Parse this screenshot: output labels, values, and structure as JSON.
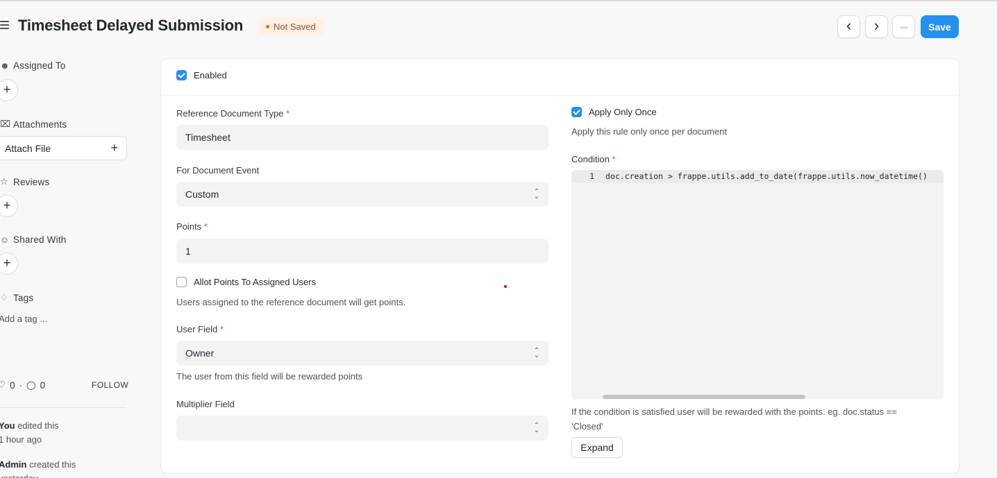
{
  "header": {
    "title": "Timesheet Delayed Submission",
    "status": "Not Saved",
    "prev_icon": "‹",
    "next_icon": "›",
    "more_icon": "···",
    "save_label": "Save"
  },
  "sidebar": {
    "assigned_to": "Assigned To",
    "attachments": "Attachments",
    "attach_file": "Attach File",
    "reviews": "Reviews",
    "shared_with": "Shared With",
    "tags": "Tags",
    "add_tag": "Add a tag ...",
    "likes": "0",
    "comments": "0",
    "follow": "FOLLOW",
    "activity": [
      {
        "who": "You",
        "text": " edited this",
        "when": "1 hour ago"
      },
      {
        "who": "Admin",
        "text": " created this",
        "when": "yesterday"
      }
    ]
  },
  "form": {
    "enabled_label": "Enabled",
    "enabled_checked": true,
    "reference_doctype_label": "Reference Document Type",
    "reference_doctype_value": "Timesheet",
    "doc_event_label": "For Document Event",
    "doc_event_value": "Custom",
    "points_label": "Points",
    "points_value": "1",
    "allot_label": "Allot Points To Assigned Users",
    "allot_checked": false,
    "allot_desc": "Users assigned to the reference document will get points.",
    "user_field_label": "User Field",
    "user_field_value": "Owner",
    "user_field_desc": "The user from this field will be rewarded points",
    "multiplier_label": "Multiplier Field",
    "multiplier_value": "",
    "apply_once_label": "Apply Only Once",
    "apply_once_checked": true,
    "apply_once_desc": "Apply this rule only once per document",
    "condition_label": "Condition",
    "condition_line_no": "1",
    "condition_code": "doc.creation > frappe.utils.add_to_date(frappe.utils.now_datetime()",
    "condition_desc_1": "If the condition is satisfied user will be rewarded with the points. eg. doc.status ==",
    "condition_desc_2": "'Closed'",
    "expand_label": "Expand",
    "required_mark": "*"
  },
  "colors": {
    "primary": "#2490ef",
    "badge_bg": "#fff1e7",
    "badge_text": "#a14b1c",
    "required": "#e24c4c"
  }
}
